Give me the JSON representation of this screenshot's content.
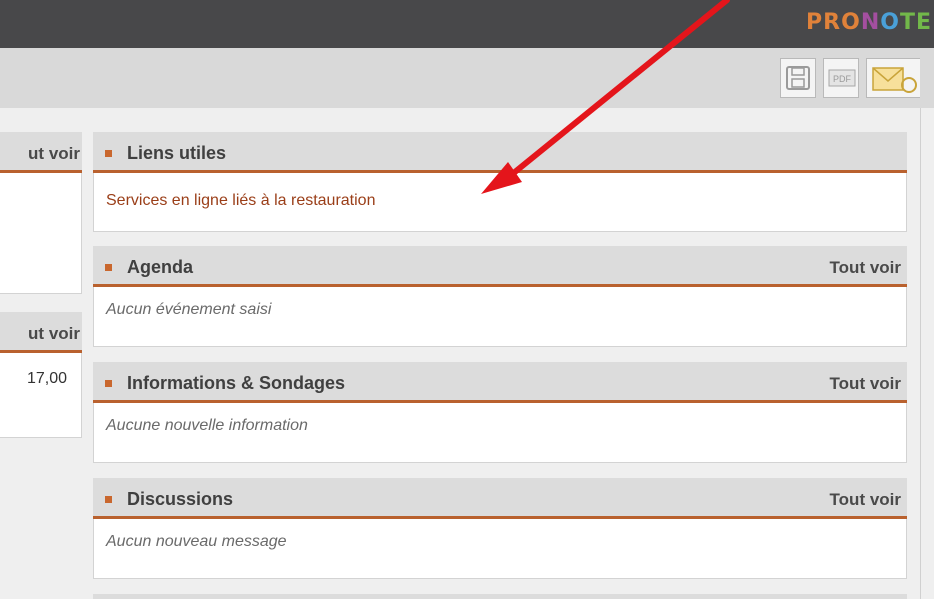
{
  "app": {
    "logo_text": [
      "PRO",
      "N",
      "O",
      "TE"
    ]
  },
  "toolbar": {
    "buttons": [
      "save-icon",
      "pdf-icon",
      "email-icon"
    ],
    "pdf_label": "PDF"
  },
  "left_column": {
    "panel1_link": "ut voir",
    "panel2_link": "ut voir",
    "panel2_value": "17,00"
  },
  "widgets": [
    {
      "title": "Liens utiles",
      "link": "",
      "body": "Services en ligne liés à la restauration"
    },
    {
      "title": "Agenda",
      "link": "Tout voir",
      "body": "Aucun événement saisi"
    },
    {
      "title": "Informations & Sondages",
      "link": "Tout voir",
      "body": "Aucune nouvelle information"
    },
    {
      "title": "Discussions",
      "link": "Tout voir",
      "body": "Aucun nouveau message"
    }
  ],
  "colors": {
    "accent": "#b9612e",
    "annotation_arrow": "#e4151b",
    "header_bar": "#48484a"
  }
}
